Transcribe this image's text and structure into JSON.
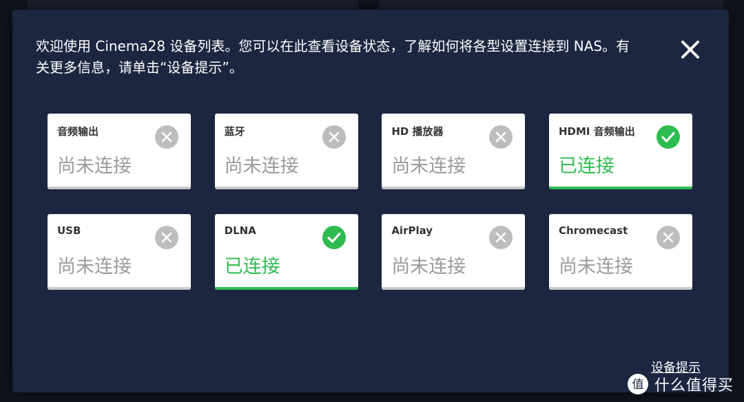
{
  "dialog": {
    "intro_text": "欢迎使用 Cinema28 设备列表。您可以在此查看设备状态，了解如何将各型设置连接到 NAS。有关更多信息，请单击“设备提示”。",
    "close_icon": "close-icon",
    "footer_link": "设备提示"
  },
  "colors": {
    "background": "#1d2640",
    "card": "#ffffff",
    "connected": "#2ebc4f",
    "disconnected": "#bdbdbd"
  },
  "devices": [
    {
      "name": "音频输出",
      "status": "尚未连接",
      "connected": false,
      "icon": "x-circle-icon"
    },
    {
      "name": "蓝牙",
      "status": "尚未连接",
      "connected": false,
      "icon": "x-circle-icon"
    },
    {
      "name": "HD 播放器",
      "status": "尚未连接",
      "connected": false,
      "icon": "x-circle-icon"
    },
    {
      "name": "HDMI 音频输出",
      "status": "已连接",
      "connected": true,
      "icon": "check-circle-icon"
    },
    {
      "name": "USB",
      "status": "尚未连接",
      "connected": false,
      "icon": "x-circle-icon"
    },
    {
      "name": "DLNA",
      "status": "已连接",
      "connected": true,
      "icon": "check-circle-icon"
    },
    {
      "name": "AirPlay",
      "status": "尚未连接",
      "connected": false,
      "icon": "x-circle-icon"
    },
    {
      "name": "Chromecast",
      "status": "尚未连接",
      "connected": false,
      "icon": "x-circle-icon"
    }
  ],
  "watermark": {
    "logo_char": "值",
    "text": "什么值得买"
  }
}
